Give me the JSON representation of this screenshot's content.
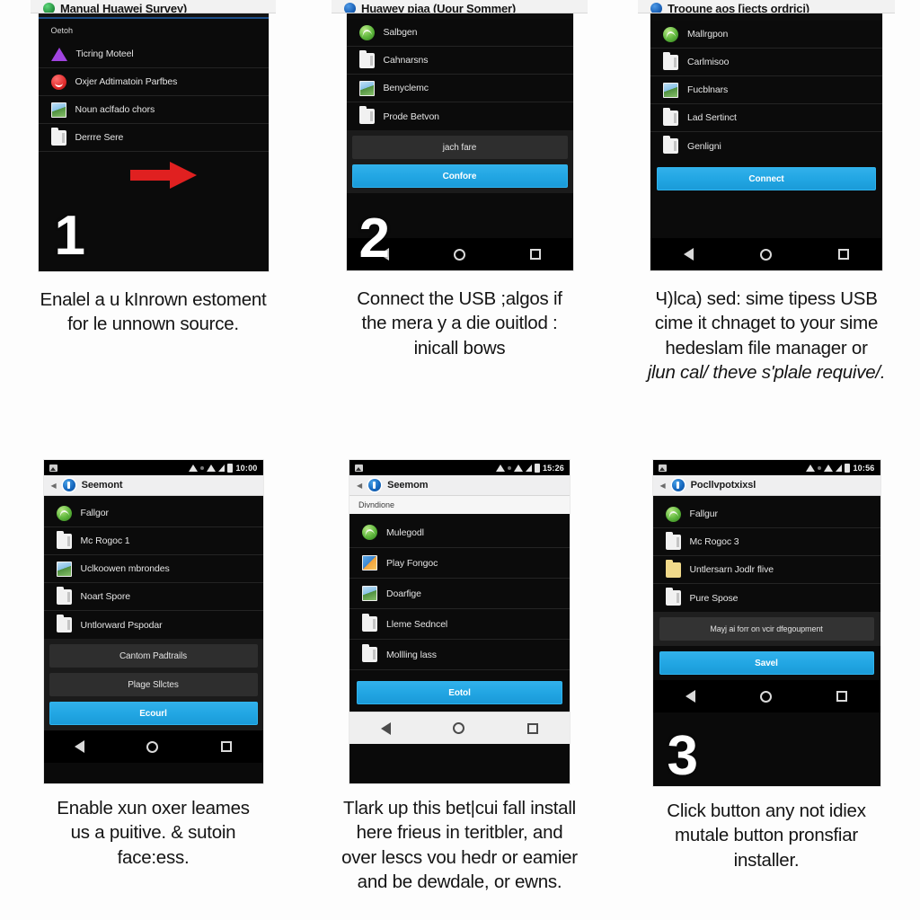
{
  "page": {
    "background": "#fdfdfd",
    "accent_blue": "#22a6e3",
    "arrow_red": "#e02020"
  },
  "panels": [
    {
      "id": "step-1",
      "step_number": "1",
      "peek_bar": {
        "text": "Manual Huawei Survey)",
        "icon": "phone-icon",
        "icon_color": "#1f8a3a"
      },
      "list_header": "Oetoh",
      "items": [
        {
          "label": "Ticring Moteel",
          "icon": "triangle-icon"
        },
        {
          "label": "Oxjer Adtimatoin Parfbes",
          "icon": "face-icon"
        },
        {
          "label": "Noun aclfado chors",
          "icon": "image-icon"
        },
        {
          "label": "Derrre Sere",
          "icon": "folder-icon"
        }
      ],
      "has_arrow": true,
      "caption_lines": [
        "Enalel a u kInrown estoment",
        "for le unnown source."
      ]
    },
    {
      "id": "step-2",
      "step_number": "2",
      "peek_bar": {
        "text": "Huawey pjaa (Uour Sommer)",
        "icon": "app-icon",
        "icon_color": "#1b62b8"
      },
      "items": [
        {
          "label": "Salbgen",
          "icon": "globe-icon"
        },
        {
          "label": "Cahnarsns",
          "icon": "folder-icon"
        },
        {
          "label": "Benyclemc",
          "icon": "image-icon"
        },
        {
          "label": "Prode Betvon",
          "icon": "folder-icon"
        }
      ],
      "buttons": [
        {
          "label": "jach fare",
          "style": "grey"
        },
        {
          "label": "Confore",
          "style": "primary"
        }
      ],
      "nav_style": "dark",
      "caption_lines": [
        "Connect the USB ;algos if",
        "the mera y a die ouitlod :",
        "inicall bows"
      ]
    },
    {
      "id": "step-3",
      "step_number": "",
      "peek_bar": {
        "text": "Trooune aos [jects ordrici)",
        "icon": "app-icon",
        "icon_color": "#1b62b8"
      },
      "items": [
        {
          "label": "Mallrgpon",
          "icon": "globe-icon"
        },
        {
          "label": "Carlmisoo",
          "icon": "folder-icon"
        },
        {
          "label": "Fucblnars",
          "icon": "image-icon"
        },
        {
          "label": "Lad Sertinct",
          "icon": "folder-icon"
        },
        {
          "label": "Genligni",
          "icon": "folder-icon"
        }
      ],
      "buttons": [
        {
          "label": "Connect",
          "style": "primary"
        }
      ],
      "nav_style": "dark",
      "caption_lines": [
        "Ч)lca) sed: sime tipess USB",
        "cime it chnaget to your sime",
        "hedeslam file manager or"
      ],
      "caption_italic_line": "jlun cal/ theve s'plale requive/."
    },
    {
      "id": "step-4",
      "step_number": "",
      "statusbar": {
        "time": "10:00",
        "icons": [
          "photo-icon",
          "wifi-icon",
          "dot-icon",
          "signal-icon",
          "battery-icon"
        ]
      },
      "appbar": {
        "title": "Seemont",
        "icon": "app-icon"
      },
      "items": [
        {
          "label": "Fallgor",
          "icon": "globe-icon"
        },
        {
          "label": "Mc Rogoc 1",
          "icon": "folder-icon"
        },
        {
          "label": "Uclkoowen mbrondes",
          "icon": "image-icon"
        },
        {
          "label": "Noart Spore",
          "icon": "folder-icon"
        },
        {
          "label": "Untlorward Pspodar",
          "icon": "folder-icon"
        }
      ],
      "buttons": [
        {
          "label": "Cantom Padtrails",
          "style": "grey"
        },
        {
          "label": "Plage Sllctes",
          "style": "grey"
        },
        {
          "label": "Ecourl",
          "style": "primary"
        }
      ],
      "nav_style": "dark",
      "caption_lines": [
        "Enable xun oxer leames",
        "us a puitive. & sutoin",
        "face:ess."
      ]
    },
    {
      "id": "step-5",
      "step_number": "",
      "statusbar": {
        "time": "15:26",
        "icons": [
          "photo-icon",
          "wifi-icon",
          "dot-icon",
          "signal-icon",
          "battery-icon"
        ]
      },
      "appbar": {
        "title": "Seemom",
        "icon": "app-icon"
      },
      "section_label": "Divndione",
      "items": [
        {
          "label": "Mulegodl",
          "icon": "globe-icon"
        },
        {
          "label": "Play Fongoc",
          "icon": "play-icon"
        },
        {
          "label": "Doarfige",
          "icon": "image-icon"
        },
        {
          "label": "Lleme Sedncel",
          "icon": "folder-icon"
        },
        {
          "label": "Mollling lass",
          "icon": "folder-icon"
        }
      ],
      "buttons": [
        {
          "label": "Eotol",
          "style": "primary"
        }
      ],
      "nav_style": "light",
      "caption_lines": [
        "Tlark up this bet|cui fall install",
        "here frieus in teritbler, and",
        "over lesсs vou hedr or eamier",
        "and be dewdale, or ewns."
      ]
    },
    {
      "id": "step-6",
      "step_number": "3",
      "statusbar": {
        "time": "10:56",
        "icons": [
          "photo-icon",
          "wifi-icon",
          "dot-icon",
          "signal-icon",
          "battery-icon"
        ]
      },
      "appbar": {
        "title": "Pocllvpotxixsl",
        "icon": "app-icon"
      },
      "items": [
        {
          "label": "Fallgur",
          "icon": "globe-icon"
        },
        {
          "label": "Mc Rogoc 3",
          "icon": "folder-icon"
        },
        {
          "label": "Untlersarn Jodlr flive",
          "icon": "folder-yellow-icon"
        },
        {
          "label": "Pure Spose",
          "icon": "folder-icon"
        }
      ],
      "buttons": [
        {
          "label": "Mayj ai forr on vcir dfegoupment",
          "style": "grey"
        },
        {
          "label": "Savel",
          "style": "primary"
        }
      ],
      "nav_style": "dark",
      "caption_lines": [
        "Click button any not idiex",
        "mutale button pronsfiar",
        "installer."
      ]
    }
  ]
}
